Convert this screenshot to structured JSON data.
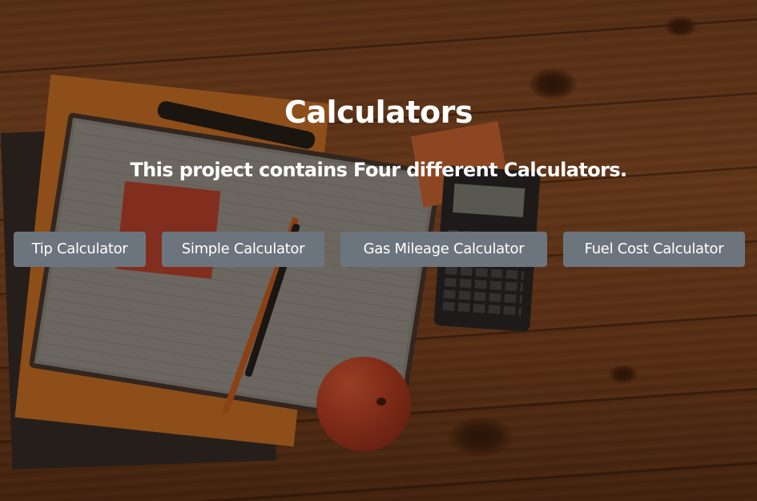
{
  "header": {
    "title": "Calculators",
    "subtitle": "This project contains Four different Calculators."
  },
  "buttons": [
    {
      "label": "Tip Calculator"
    },
    {
      "label": "Simple Calculator"
    },
    {
      "label": "Gas Mileage Calculator"
    },
    {
      "label": "Fuel Cost Calculator"
    }
  ],
  "colors": {
    "button_bg": "#6c757d",
    "text": "#ffffff",
    "wood": "#6a3a1c"
  }
}
